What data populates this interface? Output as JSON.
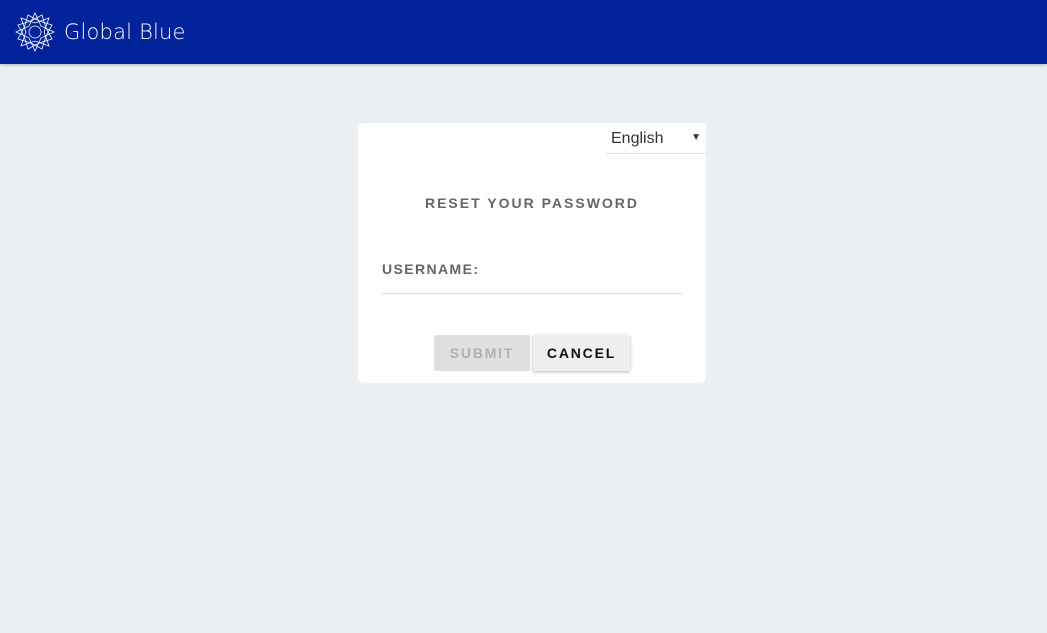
{
  "header": {
    "brand_name": "Global Blue",
    "logo_icon": "global-blue-star-logo",
    "background_color": "#00239c"
  },
  "card": {
    "language": {
      "selected": "English",
      "caret_icon": "caret-down-icon"
    },
    "title": "RESET YOUR PASSWORD",
    "username_label": "USERNAME:",
    "username_value": "",
    "submit_label": "SUBMIT",
    "cancel_label": "CANCEL"
  }
}
